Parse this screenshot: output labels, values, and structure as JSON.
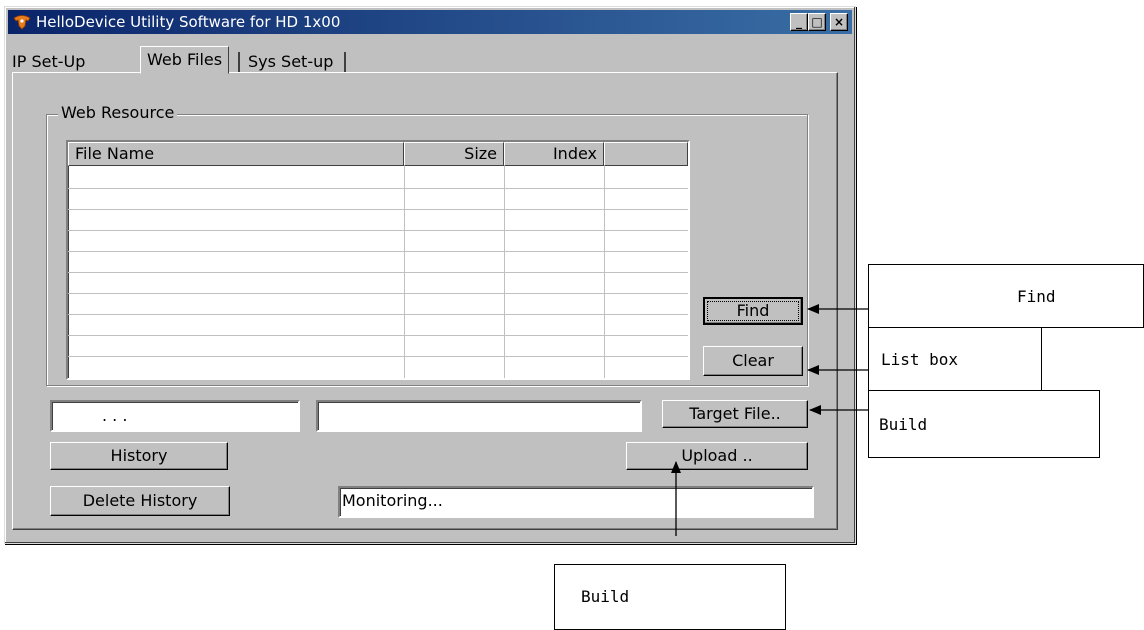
{
  "window": {
    "title": "HelloDevice Utility Software for HD 1x00",
    "minimize_glyph": "_",
    "maximize_glyph": "□",
    "close_glyph": "×"
  },
  "tabs": [
    {
      "label": "IP Set-Up",
      "active": false
    },
    {
      "label": "Web Files",
      "active": true
    },
    {
      "label": "Sys Set-up",
      "active": false
    }
  ],
  "web_resource": {
    "group_label": "Web Resource",
    "columns": [
      "File Name",
      "Size",
      "Index",
      ""
    ],
    "rows": []
  },
  "buttons": {
    "find": "Find",
    "clear": "Clear",
    "target_file": "Target File..",
    "history": "History",
    "upload": "Upload ..",
    "delete_history": "Delete History"
  },
  "fields": {
    "ip_address": ".      .      .",
    "target_path": "",
    "status": "Monitoring..."
  },
  "annotations": {
    "find": "Find",
    "list_box": "List box",
    "build_target": "Build",
    "build_upload": "Build"
  },
  "colors": {
    "titlebar_start": "#0a246a",
    "titlebar_end": "#3a6ea5",
    "face": "#c0c0c0"
  }
}
